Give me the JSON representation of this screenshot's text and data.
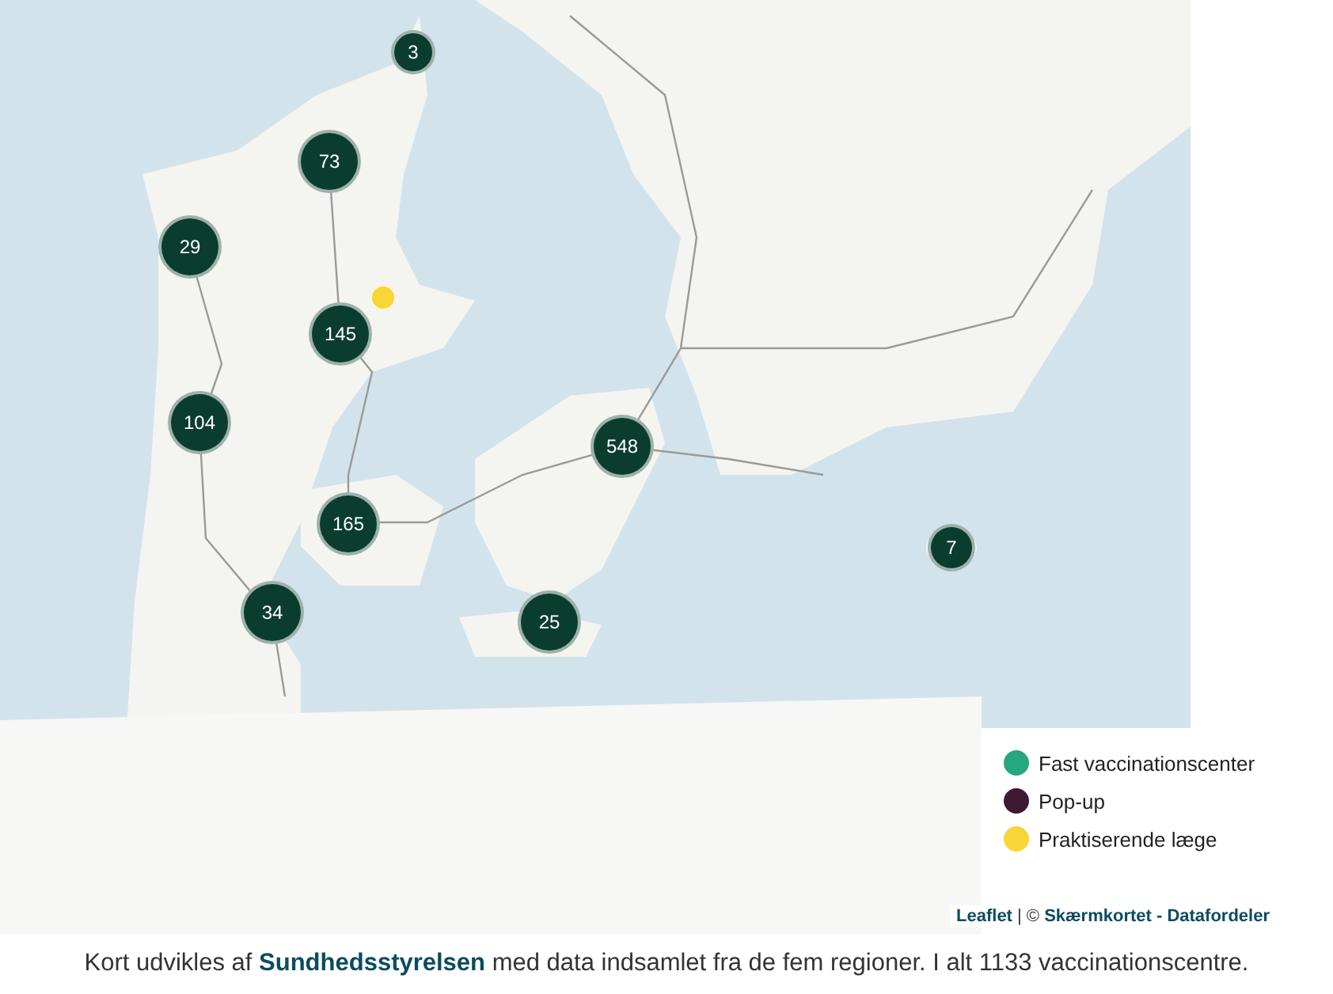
{
  "map": {
    "markers": [
      {
        "kind": "cluster",
        "label": "3"
      },
      {
        "kind": "cluster",
        "label": "73"
      },
      {
        "kind": "cluster",
        "label": "29"
      },
      {
        "kind": "point",
        "color": "#f7d635"
      },
      {
        "kind": "cluster",
        "label": "145"
      },
      {
        "kind": "cluster",
        "label": "104"
      },
      {
        "kind": "cluster",
        "label": "548"
      },
      {
        "kind": "cluster",
        "label": "165"
      },
      {
        "kind": "cluster",
        "label": "7"
      },
      {
        "kind": "cluster",
        "label": "34"
      },
      {
        "kind": "cluster",
        "label": "25"
      }
    ],
    "legend": [
      {
        "label": "Fast vaccinationscenter",
        "color": "#27a77f"
      },
      {
        "label": "Pop-up",
        "color": "#3d1a32"
      },
      {
        "label": "Praktiserende læge",
        "color": "#f7d635"
      }
    ],
    "attribution": {
      "link": "Leaflet",
      "text": "| © **Skærmkortet - Datafordeler**"
    }
  },
  "caption": "Kort udvikles af **Sundhedsstyrelsen** med data indsamlet fra de fem regioner. I alt 1133 vaccinationscentre."
}
